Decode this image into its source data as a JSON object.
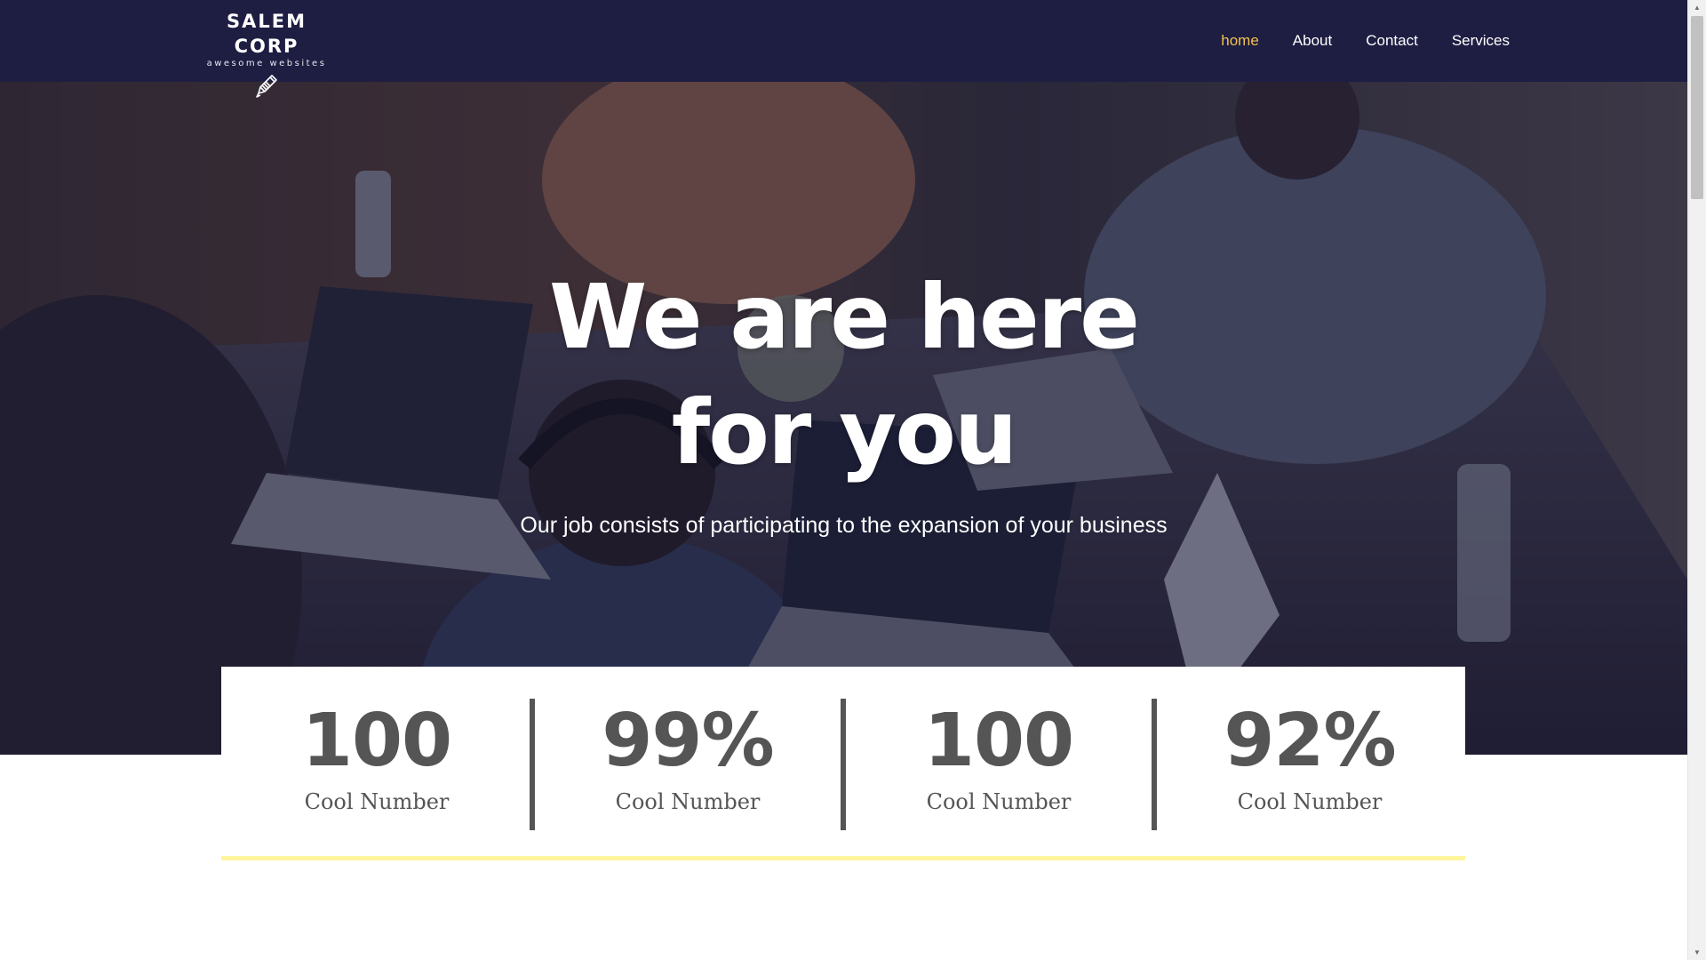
{
  "brand": {
    "name": "SALEM CORP",
    "tagline": "awesome websites",
    "icon": "pencil-icon"
  },
  "nav": {
    "items": [
      {
        "label": "home",
        "active": true
      },
      {
        "label": "About",
        "active": false
      },
      {
        "label": "Contact",
        "active": false
      },
      {
        "label": "Services",
        "active": false
      }
    ]
  },
  "hero": {
    "title_line1": "We are here",
    "title_line2": "for you",
    "subtitle": "Our job consists of participating to the expansion of your business"
  },
  "stats": [
    {
      "value": "100",
      "label": "Cool Number"
    },
    {
      "value": "99%",
      "label": "Cool Number"
    },
    {
      "value": "100",
      "label": "Cool Number"
    },
    {
      "value": "92%",
      "label": "Cool Number"
    }
  ],
  "colors": {
    "navbar_bg": "#1e1d42",
    "nav_active": "#f2c14e",
    "stat_text": "#555555",
    "accent_underline": "#fff59d"
  }
}
